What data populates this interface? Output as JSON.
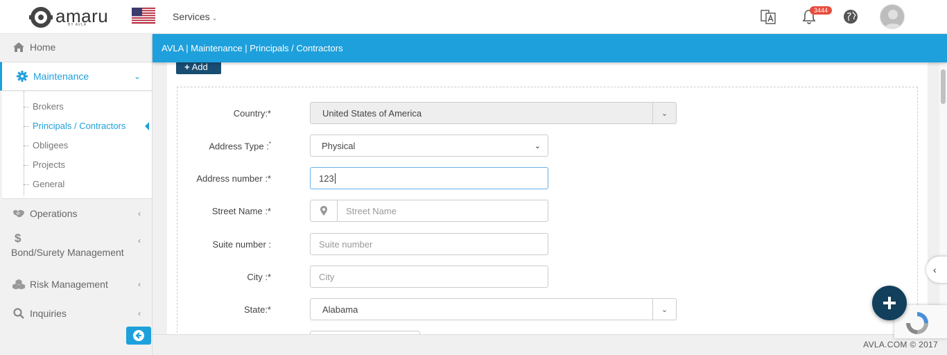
{
  "header": {
    "logo_text": "amaru",
    "logo_sub": "BY AVLA",
    "services_label": "Services",
    "notification_count": "3444"
  },
  "sidebar": {
    "home": "Home",
    "maintenance": "Maintenance",
    "sub_items": [
      "Brokers",
      "Principals / Contractors",
      "Obligees",
      "Projects",
      "General"
    ],
    "operations": "Operations",
    "bond_icon": "$",
    "bond": "Bond/Surety Management",
    "risk": "Risk Management",
    "inquiries": "Inquiries"
  },
  "breadcrumb": "AVLA | Maintenance | Principals / Contractors",
  "content": {
    "add_button": "Add"
  },
  "form": {
    "country_label": "Country:*",
    "country_value": "United States of America",
    "address_type_label": "Address Type :",
    "address_type_required": "*",
    "address_type_value": "Physical",
    "address_number_label": "Address number :*",
    "address_number_value": "123",
    "street_label": "Street Name :*",
    "street_placeholder": "Street Name",
    "suite_label": "Suite number :",
    "suite_placeholder": "Suite number",
    "city_label": "City :*",
    "city_placeholder": "City",
    "state_label": "State:*",
    "state_value": "Alabama"
  },
  "footer": "AVLA.COM © 2017",
  "colors": {
    "primary": "#1ea0dc",
    "dark_button": "#1a4d72",
    "fab": "#123f5c",
    "badge": "#e74c3c"
  },
  "icons": [
    "home-icon",
    "gear-icon",
    "handshake-icon",
    "dollar-icon",
    "cubes-icon",
    "search-icon",
    "translate-icon",
    "bell-icon",
    "globe-icon",
    "user-avatar",
    "map-marker-icon",
    "plus-icon",
    "arrow-circle-left-icon",
    "chevron-left-icon"
  ]
}
